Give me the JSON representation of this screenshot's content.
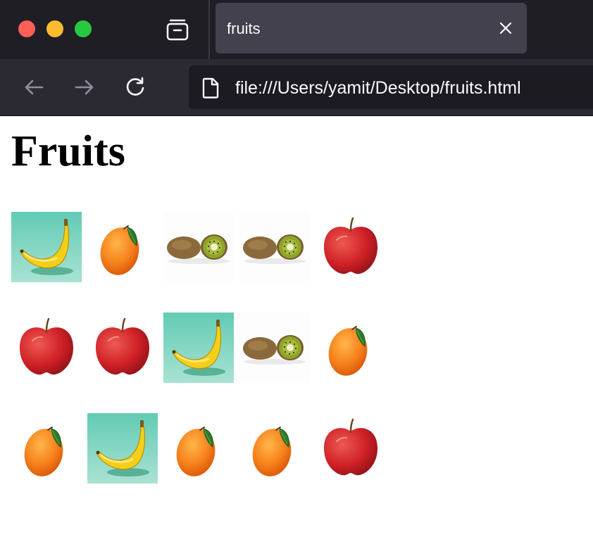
{
  "window": {
    "tab_title": "fruits",
    "url": "file:///Users/yamit/Desktop/fruits.html"
  },
  "icons": {
    "traffic_lights": [
      "close",
      "minimize",
      "zoom"
    ],
    "tab_overview": "tabs-icon",
    "tab_close": "close-icon",
    "back": "arrow-left-icon",
    "forward": "arrow-right-icon",
    "reload": "reload-icon",
    "page": "page-icon"
  },
  "colors": {
    "titlebar": "#1f1e25",
    "tab": "#42414d",
    "navbar": "#2b2a33",
    "urlbar": "#1c1b22"
  },
  "page": {
    "heading": "Fruits",
    "fruits": [
      [
        "banana",
        "orange",
        "kiwi",
        "kiwi",
        "apple"
      ],
      [
        "apple",
        "apple",
        "banana",
        "kiwi",
        "orange"
      ],
      [
        "orange",
        "banana",
        "orange",
        "orange",
        "apple"
      ]
    ]
  }
}
